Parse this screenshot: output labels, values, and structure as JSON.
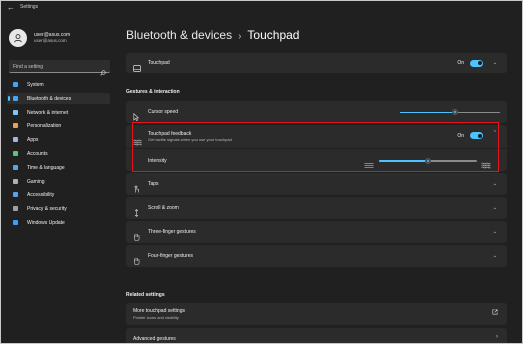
{
  "window": {
    "title": "Settings",
    "back_glyph": "←"
  },
  "user": {
    "name": "user@asus.com",
    "email": "user@asus.com",
    "avatar_icon": "person-icon"
  },
  "search": {
    "placeholder": "Find a setting",
    "icon": "search-icon"
  },
  "sidebar": {
    "items": [
      {
        "label": "System",
        "icon": "monitor-icon",
        "color": "#4aa3f0",
        "selected": false
      },
      {
        "label": "Bluetooth & devices",
        "icon": "bluetooth-icon",
        "color": "#4aa3f0",
        "selected": true
      },
      {
        "label": "Network & internet",
        "icon": "wifi-icon",
        "color": "#7fc6ff",
        "selected": false
      },
      {
        "label": "Personalization",
        "icon": "brush-icon",
        "color": "#f0a04a",
        "selected": false
      },
      {
        "label": "Apps",
        "icon": "apps-icon",
        "color": "#a0b8d8",
        "selected": false
      },
      {
        "label": "Accounts",
        "icon": "person-icon",
        "color": "#5fc36f",
        "selected": false
      },
      {
        "label": "Time & language",
        "icon": "globe-icon",
        "color": "#58a6e8",
        "selected": false
      },
      {
        "label": "Gaming",
        "icon": "controller-icon",
        "color": "#b0b0b0",
        "selected": false
      },
      {
        "label": "Accessibility",
        "icon": "accessibility-icon",
        "color": "#5aa0f0",
        "selected": false
      },
      {
        "label": "Privacy & security",
        "icon": "shield-icon",
        "color": "#a0a0a0",
        "selected": false
      },
      {
        "label": "Windows Update",
        "icon": "update-icon",
        "color": "#3aa0ff",
        "selected": false
      }
    ]
  },
  "breadcrumb": {
    "parent": "Bluetooth & devices",
    "separator": "›",
    "current": "Touchpad"
  },
  "touchpad": {
    "label": "Touchpad",
    "state": "On",
    "icon": "touchpad-icon"
  },
  "gestures_section": {
    "title": "Gestures & interaction"
  },
  "cursor_speed": {
    "label": "Cursor speed",
    "icon": "cursor-icon",
    "value": 0.55
  },
  "feedback": {
    "label": "Touchpad feedback",
    "description": "Get tactile signals when you use your touchpad",
    "state": "On",
    "icon": "vibration-icon",
    "intensity_label": "Intensity",
    "intensity": 0.5
  },
  "rows": [
    {
      "label": "Taps",
      "icon": "tap-icon"
    },
    {
      "label": "Scroll & zoom",
      "icon": "scroll-icon"
    },
    {
      "label": "Three-finger gestures",
      "icon": "hand-icon"
    },
    {
      "label": "Four-finger gestures",
      "icon": "hand-icon"
    }
  ],
  "related_section": {
    "title": "Related settings"
  },
  "related": [
    {
      "label": "More touchpad settings",
      "description": "Pointer icons and visibility",
      "icon": "external-link-icon"
    },
    {
      "label": "Advanced gestures",
      "icon": "chevron-right-icon"
    }
  ],
  "accent_color": "#4cc2ff",
  "highlight_color": "#e3141b"
}
